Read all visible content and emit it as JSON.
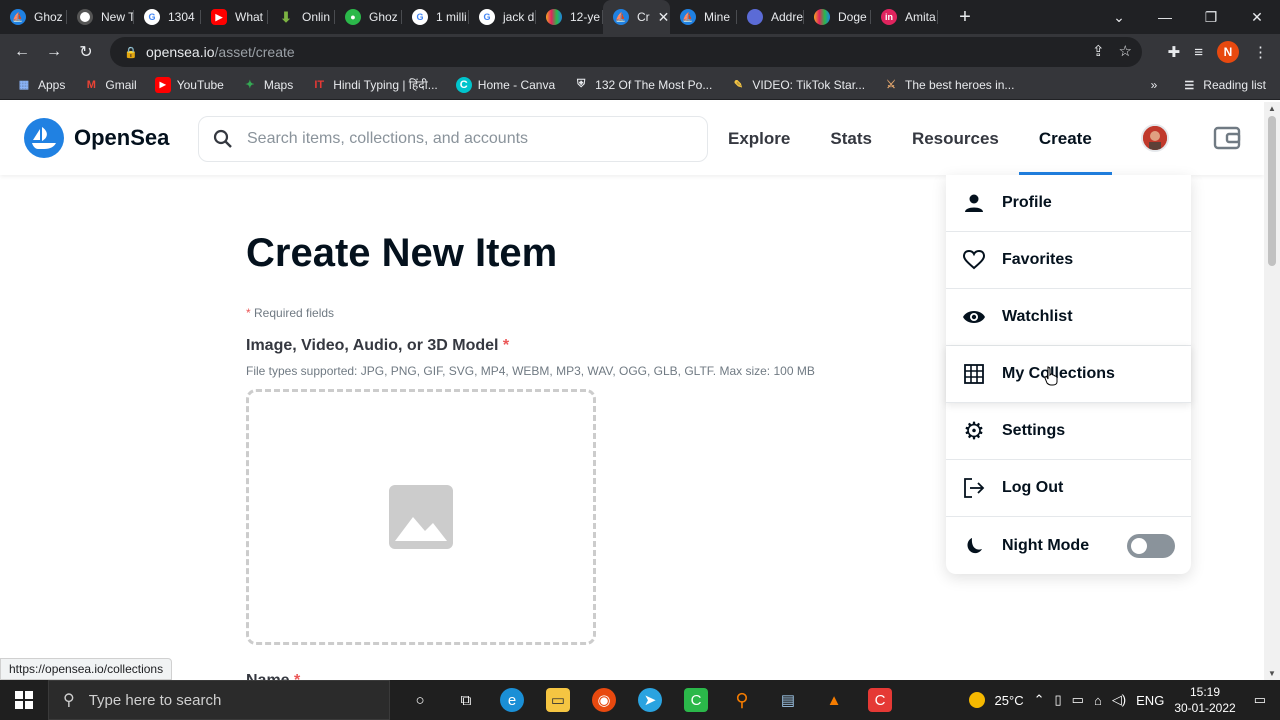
{
  "browser": {
    "tabs": [
      {
        "label": "Ghoz",
        "icon": "opensea-icon",
        "color": "#2081e2"
      },
      {
        "label": "New T",
        "icon": "chrome-icon",
        "color": "#ffffff"
      },
      {
        "label": "1304",
        "icon": "google-icon",
        "color": "#ffffff"
      },
      {
        "label": "What",
        "icon": "youtube-icon",
        "color": "#ff0000"
      },
      {
        "label": "Onlin",
        "icon": "download-icon",
        "color": "#7cb342"
      },
      {
        "label": "Ghoz",
        "icon": "chat-icon",
        "color": "#2bb84a"
      },
      {
        "label": "1 milli",
        "icon": "google-icon",
        "color": "#ffffff"
      },
      {
        "label": "jack d",
        "icon": "google-icon",
        "color": "#ffffff"
      },
      {
        "label": "12-ye",
        "icon": "nbc-icon",
        "color": "#f5a623"
      },
      {
        "label": "Cr",
        "icon": "opensea-icon",
        "color": "#2081e2",
        "active": true
      },
      {
        "label": "Mine",
        "icon": "opensea-icon",
        "color": "#2081e2"
      },
      {
        "label": "Addre",
        "icon": "ens-icon",
        "color": "#5b6bd6"
      },
      {
        "label": "Doge",
        "icon": "nbc-icon",
        "color": "#f5a623"
      },
      {
        "label": "Amita",
        "icon": "instagram-icon",
        "color": "#e0245e"
      }
    ],
    "url_host": "opensea.io",
    "url_path": "/asset/create",
    "profile_initial": "N",
    "bookmarks": [
      {
        "label": "Apps",
        "icon": "apps-grid-icon"
      },
      {
        "label": "Gmail",
        "icon": "gmail-icon"
      },
      {
        "label": "YouTube",
        "icon": "youtube-icon"
      },
      {
        "label": "Maps",
        "icon": "maps-icon"
      },
      {
        "label": "Hindi Typing | हिंदी...",
        "icon": "it-icon"
      },
      {
        "label": "Home - Canva",
        "icon": "canva-icon"
      },
      {
        "label": "132 Of The Most Po...",
        "icon": "shield-icon"
      },
      {
        "label": "VIDEO: TikTok Star...",
        "icon": "feather-icon"
      },
      {
        "label": "The best heroes in...",
        "icon": "hero-icon"
      }
    ],
    "bookmarks_more": "»",
    "reading_list": "Reading list",
    "status_url": "https://opensea.io/collections"
  },
  "opensea": {
    "brand": "OpenSea",
    "brand_color": "#2081e2",
    "search_placeholder": "Search items, collections, and accounts",
    "nav": [
      "Explore",
      "Stats",
      "Resources",
      "Create"
    ],
    "active_nav": "Create"
  },
  "page": {
    "title": "Create New Item",
    "required_star": "*",
    "required_text": " Required fields",
    "media_label": "Image, Video, Audio, or 3D Model",
    "media_star": " *",
    "media_hint": "File types supported: JPG, PNG, GIF, SVG, MP4, WEBM, MP3, WAV, OGG, GLB, GLTF. Max size: 100 MB",
    "name_label": "Name",
    "name_star": " *"
  },
  "menu": {
    "items": [
      {
        "label": "Profile",
        "icon": "person-icon"
      },
      {
        "label": "Favorites",
        "icon": "heart-icon"
      },
      {
        "label": "Watchlist",
        "icon": "eye-icon"
      },
      {
        "label": "My Collections",
        "icon": "grid-icon",
        "hovered": true
      },
      {
        "label": "Settings",
        "icon": "gear-icon"
      },
      {
        "label": "Log Out",
        "icon": "logout-icon"
      },
      {
        "label": "Night Mode",
        "icon": "moon-icon",
        "toggle": false
      }
    ]
  },
  "taskbar": {
    "search_placeholder": "Type here to search",
    "weather": "25°C",
    "language": "ENG",
    "time": "15:19",
    "date": "30-01-2022"
  }
}
